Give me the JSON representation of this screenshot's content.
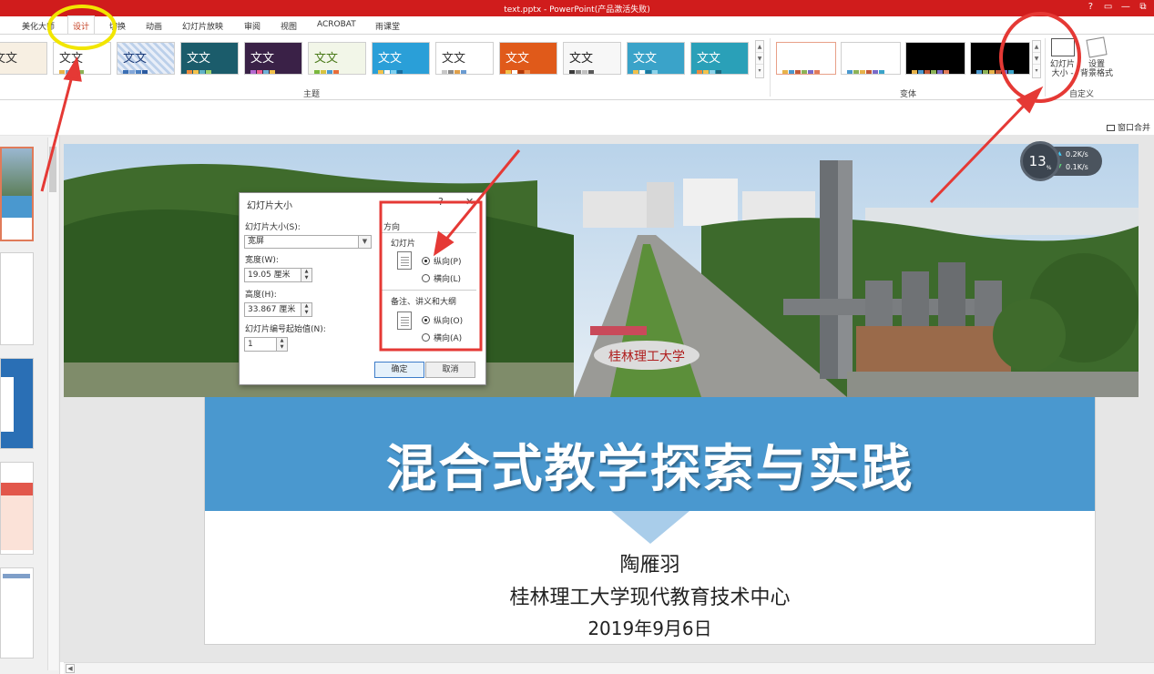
{
  "window": {
    "title": "text.pptx - PowerPoint(产品激活失败)",
    "controls": [
      "?",
      "▭",
      "—",
      "⧉"
    ]
  },
  "tabs": [
    {
      "label": "美化大师"
    },
    {
      "label": "设计",
      "active": true
    },
    {
      "label": "切换"
    },
    {
      "label": "动画"
    },
    {
      "label": "幻灯片放映"
    },
    {
      "label": "审阅"
    },
    {
      "label": "视图"
    },
    {
      "label": "ACROBAT"
    },
    {
      "label": "雨课堂"
    }
  ],
  "ribbon": {
    "themes_group_label": "主题",
    "variants_group_label": "变体",
    "customize_group_label": "自定义",
    "theme_text": "文文",
    "slide_size_label": "幻灯片\n大小 -",
    "format_bg_label": "设置\n背景格式",
    "themes": [
      {
        "bg": "#ffffff",
        "fg": "#333333",
        "bars": [
          "#e7b34a",
          "#7ca3c9",
          "#c45a3a",
          "#8cb357"
        ]
      },
      {
        "bg": "#e8eef8",
        "fg": "#1d3d7a",
        "bars": [
          "#3b6fb5",
          "#83a7d9",
          "#4a7fc1",
          "#2a5aa0"
        ],
        "pattern": true
      },
      {
        "bg": "#1b5c6b",
        "fg": "#ffffff",
        "bars": [
          "#ef8a3a",
          "#f4c24a",
          "#60b3c7",
          "#a0d26a"
        ]
      },
      {
        "bg": "#3a2147",
        "fg": "#ffffff",
        "bars": [
          "#b46ad1",
          "#ef5f8f",
          "#6fb2d8",
          "#f1c04a"
        ]
      },
      {
        "bg": "#f2f6e8",
        "fg": "#4a7a1a",
        "bars": [
          "#7ab83d",
          "#d7c33f",
          "#4a9bd1",
          "#e86d3a"
        ]
      },
      {
        "bg": "#2a9fd8",
        "fg": "#ffffff",
        "bars": [
          "#f4c24a",
          "#ffffff",
          "#7fd0f0",
          "#1a6fa0"
        ]
      },
      {
        "bg": "#ffffff",
        "fg": "#333333",
        "bars": [
          "#c7c7c7",
          "#8a8a8a",
          "#e0a04a",
          "#6a9bd1"
        ]
      },
      {
        "bg": "#e05a1a",
        "fg": "#ffffff",
        "bars": [
          "#f4c24a",
          "#ffffff",
          "#b03a0a",
          "#f08a4a"
        ]
      },
      {
        "bg": "#f7f7f7",
        "fg": "#222222",
        "bars": [
          "#3a3a3a",
          "#8a8a8a",
          "#c0c0c0",
          "#5a5a5a"
        ]
      },
      {
        "bg": "#3aa3c9",
        "fg": "#ffffff",
        "bars": [
          "#f1c04a",
          "#ffffff",
          "#1d7aa0",
          "#8fd3ea"
        ]
      },
      {
        "bg": "#2aa0b8",
        "fg": "#ffffff",
        "bars": [
          "#ef8a3a",
          "#f4c24a",
          "#8fd3ea",
          "#1d6a80"
        ]
      }
    ],
    "variants": [
      {
        "bg": "#ffffff",
        "selected": true,
        "bars": [
          "#e7b34a",
          "#4a98cf",
          "#c45a3a",
          "#8cb357",
          "#7a6ac9",
          "#e07b5a"
        ]
      },
      {
        "bg": "#ffffff",
        "bars": [
          "#4a98cf",
          "#8cb357",
          "#e7b34a",
          "#c45a3a",
          "#7a6ac9",
          "#3aa3c9"
        ]
      },
      {
        "bg": "#000000",
        "bars": [
          "#e7b34a",
          "#4a98cf",
          "#c45a3a",
          "#8cb357",
          "#7a6ac9",
          "#e07b5a"
        ]
      },
      {
        "bg": "#000000",
        "bars": [
          "#4a98cf",
          "#8cb357",
          "#e7b34a",
          "#c45a3a",
          "#7a6ac9",
          "#3aa3c9"
        ]
      }
    ]
  },
  "subbar": {
    "merge_label": "窗口合并"
  },
  "net_widget": {
    "percent": "13",
    "percent_unit": "%",
    "up": "0.2K/s",
    "down": "0.1K/s"
  },
  "dialog": {
    "title": "幻灯片大小",
    "help": "?",
    "close": "✕",
    "size_label": "幻灯片大小(S):",
    "size_value": "宽屏",
    "width_label": "宽度(W):",
    "width_value": "19.05 厘米",
    "height_label": "高度(H):",
    "height_value": "33.867 厘米",
    "start_label": "幻灯片编号起始值(N):",
    "start_value": "1",
    "orientation_label": "方向",
    "slides_label": "幻灯片",
    "slides_portrait": "纵向(P)",
    "slides_landscape": "横向(L)",
    "notes_label": "备注、讲义和大纲",
    "notes_portrait": "纵向(O)",
    "notes_landscape": "横向(A)",
    "ok": "确定",
    "cancel": "取消"
  },
  "slide": {
    "title": "混合式教学探索与实践",
    "author": "陶雁羽",
    "org": "桂林理工大学现代教育技术中心",
    "date": "2019年9月6日",
    "gate_sign": "桂林理工大学"
  },
  "colors": {
    "titlebar": "#d01c1c",
    "banner": "#4a98cf",
    "annotation_red": "#e53935",
    "annotation_yellow": "#f2e600"
  }
}
